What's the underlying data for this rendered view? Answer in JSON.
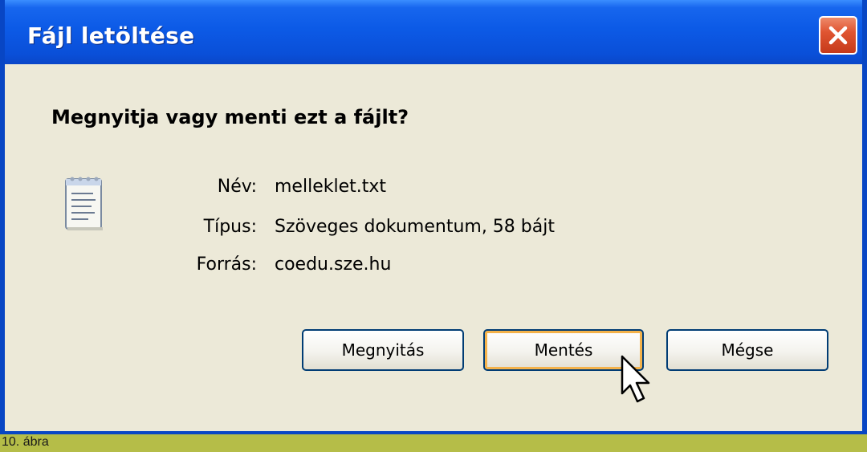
{
  "window": {
    "title": "Fájl letöltése",
    "question": "Megnyitja vagy menti ezt a fájlt?"
  },
  "file": {
    "icon": "text-file-icon",
    "name_label": "Név:",
    "name_value": "melleklet.txt",
    "type_label": "Típus:",
    "type_value": "Szöveges dokumentum, 58 bájt",
    "source_label": "Forrás:",
    "source_value": "coedu.sze.hu"
  },
  "buttons": {
    "open": "Megnyitás",
    "save": "Mentés",
    "cancel": "Mégse"
  },
  "caption": "10. ábra",
  "colors": {
    "titlebar": "#0a50d8",
    "client": "#ece9d8",
    "close": "#e05532",
    "caption_bar": "#b5bd48",
    "default_focus": "#f4b24a"
  }
}
